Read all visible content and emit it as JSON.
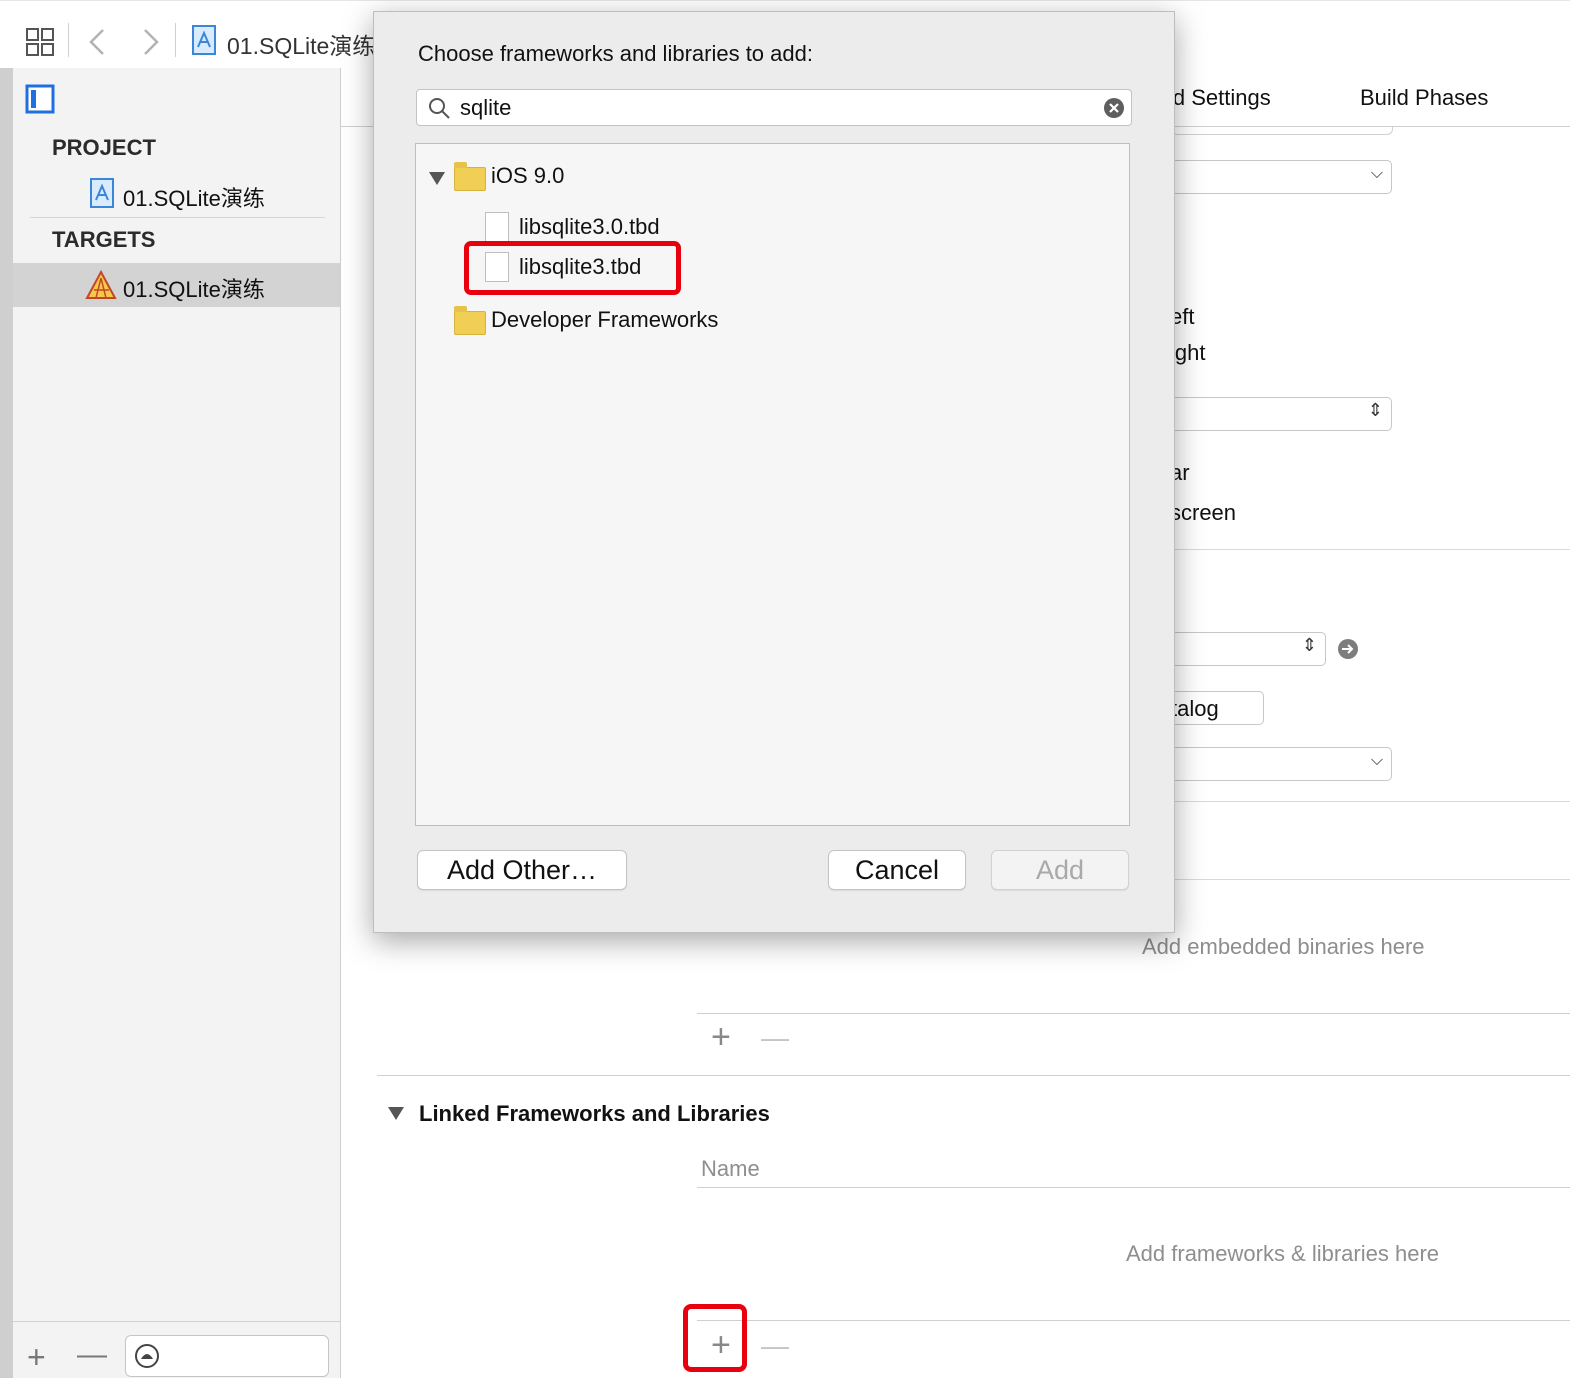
{
  "toolbar": {
    "project_title": "01.SQLite演练"
  },
  "sidebar": {
    "project_header": "PROJECT",
    "project_item": "01.SQLite演练",
    "targets_header": "TARGETS",
    "target_item": "01.SQLite演练"
  },
  "tabs": {
    "build_settings": "ld Settings",
    "build_phases": "Build Phases"
  },
  "background_fragments": {
    "eft": "eft",
    "ight": "ight",
    "ar": "ar",
    "screen": "screen",
    "catalog": "talog"
  },
  "embedded": {
    "placeholder": "Add embedded binaries here"
  },
  "linked": {
    "title": "Linked Frameworks and Libraries",
    "column_name": "Name",
    "placeholder": "Add frameworks & libraries here"
  },
  "dialog": {
    "title": "Choose frameworks and libraries to add:",
    "search_value": "sqlite",
    "tree": {
      "group_ios": "iOS 9.0",
      "file_1": "libsqlite3.0.tbd",
      "file_2": "libsqlite3.tbd",
      "group_dev": "Developer Frameworks"
    },
    "buttons": {
      "add_other": "Add Other…",
      "cancel": "Cancel",
      "add": "Add"
    }
  },
  "colors": {
    "highlight": "#e8000f",
    "accent": "#1f6fe0"
  }
}
